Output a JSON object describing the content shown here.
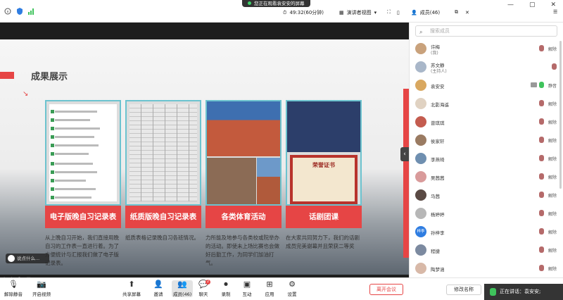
{
  "banner": {
    "text": "您正在观看袁安安的屏幕"
  },
  "top": {
    "timer": "49:32(60分钟)",
    "view_mode": "演讲者视图",
    "members_tab": "成员(46)"
  },
  "slide": {
    "title": "成果展示",
    "cards": [
      {
        "label": "电子版晚自习记录表",
        "desc": "从上晚自习开始，我们直接用晚自习的工作表一直进行着。为了方便统计与汇报我们做了电子版记录表。"
      },
      {
        "label": "纸质版晚自习记录表",
        "desc": "纸质表格记录晚自习各班情况。"
      },
      {
        "label": "各类体育活动",
        "desc": "力所能及地参与各类校或院举办的活动。即使未上场比赛也会做好后勤工作，为同学们加油打气。"
      },
      {
        "label": "话剧团课",
        "desc": "在大家共同努力下，我们的话剧成员完美谢幕并且荣获二等奖"
      }
    ],
    "certificate_text": "荣誉证书"
  },
  "chat_pill": "说点什么...",
  "panel": {
    "search_placeholder": "搜索成员",
    "members": [
      {
        "name": "许梅",
        "role": "(我)",
        "color": "#c9a27c",
        "mic": "muted",
        "action": "解除"
      },
      {
        "name": "苏文静",
        "role": "(主持人)",
        "color": "#a9b7c9",
        "mic": "muted",
        "action": ""
      },
      {
        "name": "袁安安",
        "role": "",
        "color": "#d9a860",
        "mic": "on",
        "cam": true,
        "action": "静音"
      },
      {
        "name": "北影海遥",
        "role": "",
        "color": "#e0d2c2",
        "mic": "muted",
        "action": "解除"
      },
      {
        "name": "曾琪琪",
        "role": "",
        "color": "#c45c4f",
        "mic": "muted",
        "action": "解除"
      },
      {
        "name": "侯家轩",
        "role": "",
        "color": "#9a7b62",
        "mic": "muted",
        "action": "解除"
      },
      {
        "name": "李燕琦",
        "role": "",
        "color": "#6f8fb0",
        "mic": "muted",
        "action": "解除"
      },
      {
        "name": "吴茜茜",
        "role": "",
        "color": "#d99b9b",
        "mic": "muted",
        "action": "解除"
      },
      {
        "name": "马茜",
        "role": "",
        "color": "#5a4a44",
        "mic": "muted",
        "action": "解除"
      },
      {
        "name": "杨婷婷",
        "role": "",
        "color": "#b7b7b7",
        "mic": "muted",
        "action": "解除"
      },
      {
        "name": "孙梓李",
        "role": "",
        "color": "#2f7de1",
        "initials": "梓李",
        "mic": "muted",
        "action": "解除"
      },
      {
        "name": "程捷",
        "role": "",
        "color": "#7c8aa0",
        "mic": "muted",
        "action": "解除"
      },
      {
        "name": "陶梦涵",
        "role": "",
        "color": "#d8b9a8",
        "mic": "muted",
        "action": "解除"
      }
    ]
  },
  "toolbar": {
    "unmute": "解除静音",
    "start_video": "开启视频",
    "share": "共享屏幕",
    "invite": "邀请",
    "members": "成员(46)",
    "chat": "聊天",
    "chat_badge": "2",
    "record": "录制",
    "apps": "应用",
    "settings": "设置",
    "interact": "互动",
    "leave": "离开会议",
    "rename": "修改名称"
  },
  "speaking": "正在讲话：袁安安;"
}
